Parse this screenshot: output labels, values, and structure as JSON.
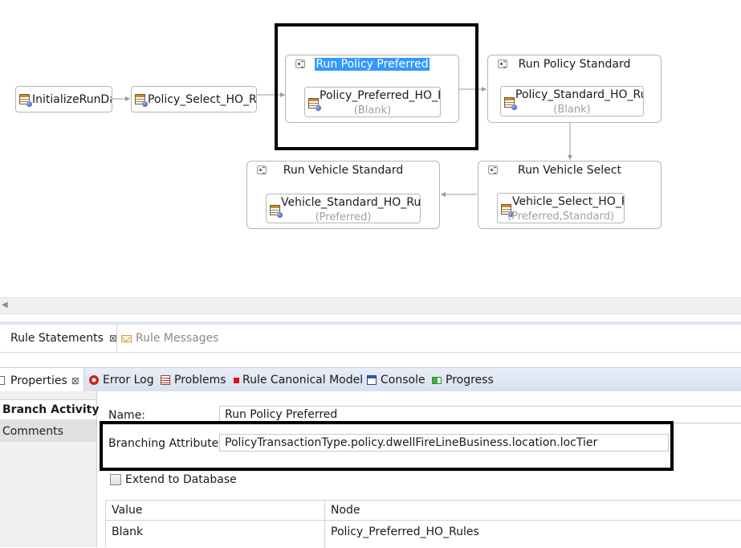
{
  "diagram": {
    "nodes": {
      "initialize": "InitializeRunDa",
      "policy_select": "Policy_Select_HO_Ru"
    },
    "groups": {
      "run_policy_preferred": {
        "title": "Run Policy Preferred",
        "rule": "Policy_Preferred_HO_R",
        "branch": "(Blank)"
      },
      "run_policy_standard": {
        "title": "Run Policy Standard",
        "rule": "Policy_Standard_HO_Ru",
        "branch": "(Blank)"
      },
      "run_vehicle_select": {
        "title": "Run Vehicle Select",
        "rule": "Vehicle_Select_HO_R",
        "branch": "(Preferred,Standard)"
      },
      "run_vehicle_standard": {
        "title": "Run Vehicle Standard",
        "rule": "Vehicle_Standard_HO_Rule",
        "branch": "(Preferred)"
      }
    }
  },
  "top_tabs": {
    "rule_statements": "Rule Statements",
    "rule_messages": "Rule Messages"
  },
  "view_tabs": {
    "properties": "Properties",
    "error_log": "Error Log",
    "problems": "Problems",
    "rule_canonical_model": "Rule Canonical Model",
    "console": "Console",
    "progress": "Progress"
  },
  "properties": {
    "nav": {
      "branch_activity": "Branch Activity",
      "comments": "Comments"
    },
    "name_label": "Name:",
    "name_value": "Run Policy Preferred",
    "branching_label": "Branching Attribute:",
    "branching_value": "PolicyTransactionType.policy.dwellFireLineBusiness.location.locTier",
    "extend_label": "Extend to Database",
    "extend_checked": false,
    "table": {
      "headers": {
        "value": "Value",
        "node": "Node"
      },
      "rows": [
        {
          "value": "Blank",
          "node": "Policy_Preferred_HO_Rules"
        }
      ]
    }
  },
  "colors": {
    "selection": "#3399ff",
    "highlight_box": "#000000",
    "tab_strip": "#d6e0f0"
  }
}
